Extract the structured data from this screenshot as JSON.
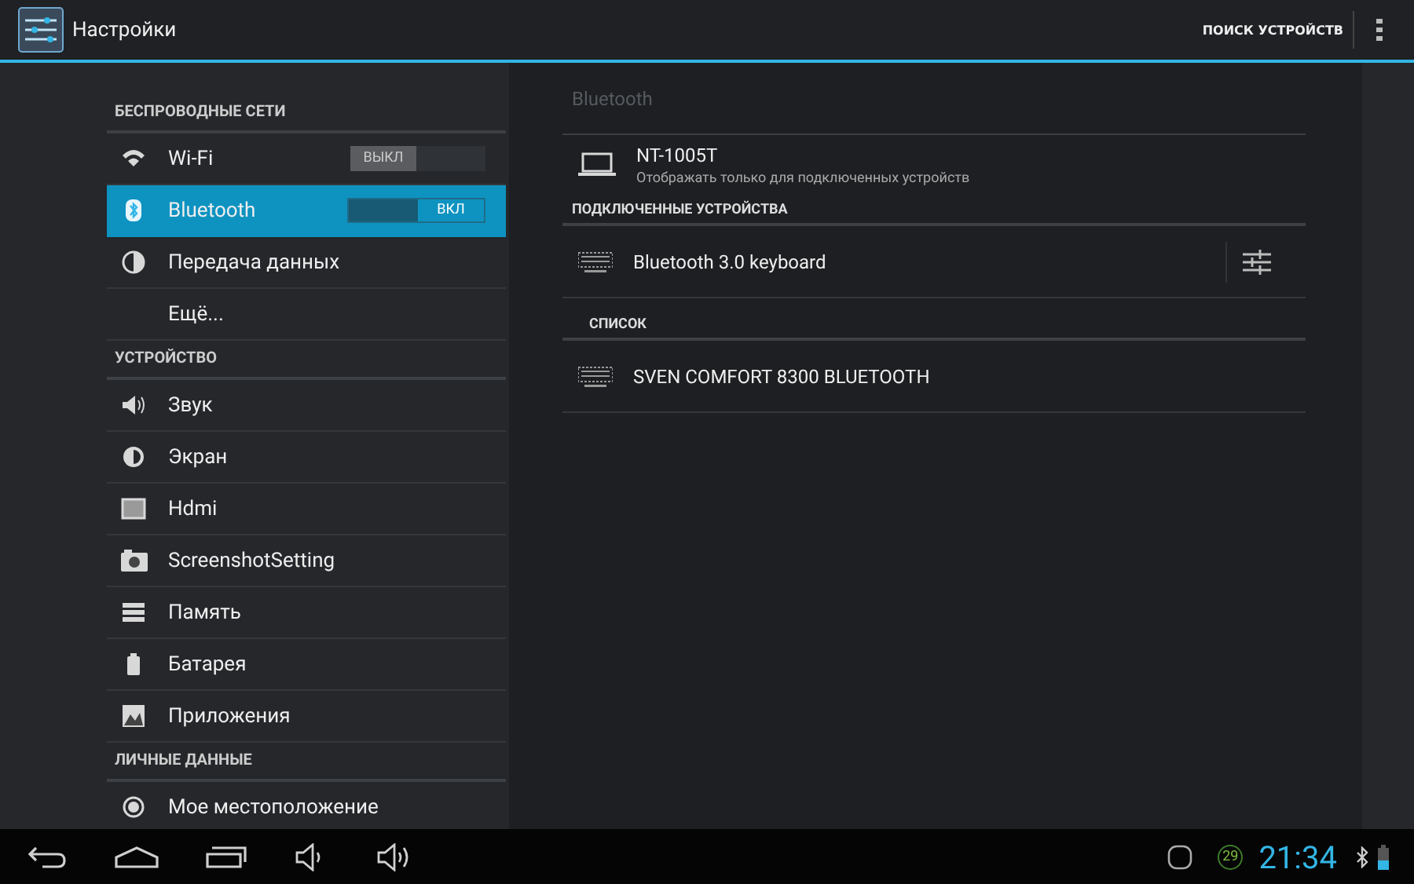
{
  "action_bar": {
    "title": "Настройки",
    "action": "ПОИСК УСТРОЙСТВ"
  },
  "sidebar": {
    "items": [
      {
        "kind": "header",
        "label": "БЕСПРОВОДНЫЕ СЕТИ"
      },
      {
        "kind": "toggle",
        "label": "Wi-Fi",
        "selected": false,
        "switch": {
          "on": false,
          "label": "ВЫКЛ"
        }
      },
      {
        "kind": "toggle",
        "label": "Bluetooth",
        "selected": true,
        "switch": {
          "on": true,
          "label": "ВКЛ"
        }
      },
      {
        "kind": "item",
        "label": "Передача данных",
        "selected": false
      },
      {
        "kind": "item",
        "label": "Ещё...",
        "selected": false
      },
      {
        "kind": "header",
        "label": "УСТРОЙСТВО"
      },
      {
        "kind": "item",
        "label": "Звук",
        "selected": false
      },
      {
        "kind": "item",
        "label": "Экран",
        "selected": false
      },
      {
        "kind": "item",
        "label": "Hdmi",
        "selected": false
      },
      {
        "kind": "item",
        "label": "ScreenshotSetting",
        "selected": false
      },
      {
        "kind": "item",
        "label": "Память",
        "selected": false
      },
      {
        "kind": "item",
        "label": "Батарея",
        "selected": false
      },
      {
        "kind": "item",
        "label": "Приложения",
        "selected": false
      },
      {
        "kind": "header",
        "label": "ЛИЧНЫЕ ДАННЫЕ"
      },
      {
        "kind": "item",
        "label": "Мое местоположение",
        "selected": false
      }
    ]
  },
  "panel": {
    "title": "Bluetooth",
    "device": {
      "name": "NT-1005T",
      "subtitle": "Отображать только для подключенных устройств"
    },
    "sections": [
      {
        "title": "ПОДКЛЮЧЕННЫЕ УСТРОЙСТВА",
        "indent": false,
        "devices": [
          {
            "name": "Bluetooth 3.0 keyboard",
            "settings": true
          }
        ]
      },
      {
        "title": "СПИСОК",
        "indent": true,
        "devices": [
          {
            "name": "SVEN COMFORT 8300 BLUETOOTH",
            "settings": false
          }
        ]
      }
    ]
  },
  "status_bar": {
    "notification_count": "29",
    "time": "21:34"
  }
}
